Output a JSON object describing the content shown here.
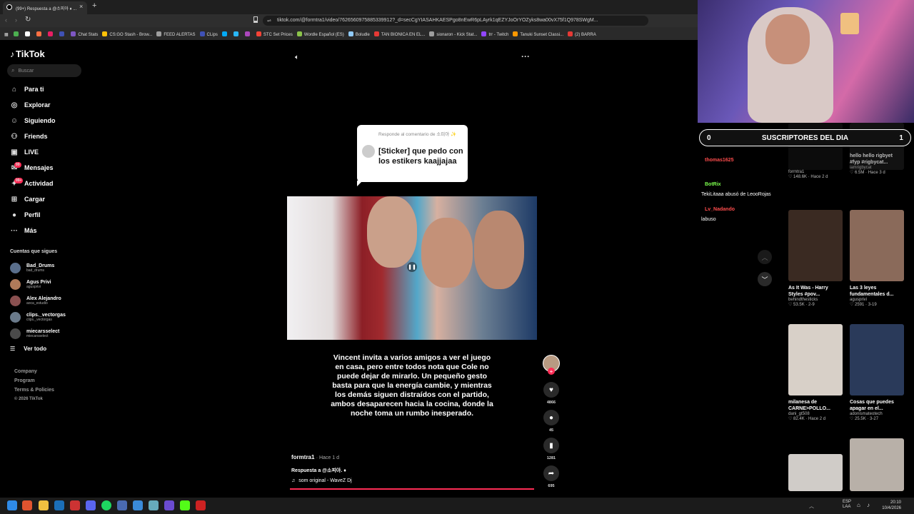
{
  "browser": {
    "tab_title": "(99+) Respuesta a @소피아 ♦ ...",
    "new_tab": "+",
    "url": "tiktok.com/@formtra1/video/7626560975885339912?_d=secCgYIASAHKAESPgo8nEwR6pLAyrk1qEZYJoOrYOZyks8wa00vX75f1Q978SWgM...",
    "bookmarks": [
      {
        "label": "",
        "color": "#4caf50"
      },
      {
        "label": "",
        "color": "#ffffff"
      },
      {
        "label": "",
        "color": "#ff7043"
      },
      {
        "label": "",
        "color": "#e91e63"
      },
      {
        "label": "",
        "color": "#3f51b5"
      },
      {
        "label": "Chat Stats",
        "color": "#7e57c2"
      },
      {
        "label": "CS:GO Stash - Brow...",
        "color": "#ffc107"
      },
      {
        "label": "FEED ALERTAS",
        "color": "#9e9e9e"
      },
      {
        "label": "CLips",
        "color": "#3f51b5"
      },
      {
        "label": "",
        "color": "#03a9f4"
      },
      {
        "label": "",
        "color": "#29b6f6"
      },
      {
        "label": "",
        "color": "#ab47bc"
      },
      {
        "label": "STC Set Prices",
        "color": "#f44336"
      },
      {
        "label": "Wordle Español (ES)",
        "color": "#8bc34a"
      },
      {
        "label": "Boludle",
        "color": "#90caf9"
      },
      {
        "label": "TAN BIONICA EN EL...",
        "color": "#e53935"
      },
      {
        "label": "sionaron - Kick Stat...",
        "color": "#9e9e9e"
      },
      {
        "label": "trr - Twitch",
        "color": "#9146ff"
      },
      {
        "label": "Tanuki Sunset Classi...",
        "color": "#ff9800"
      },
      {
        "label": "(2) BARRA",
        "color": "#e53935"
      }
    ]
  },
  "tiktok": {
    "logo": "TikTok",
    "search_placeholder": "Buscar",
    "nav": [
      {
        "label": "Para ti",
        "icon": "home-icon",
        "badge": ""
      },
      {
        "label": "Explorar",
        "icon": "compass-icon",
        "badge": ""
      },
      {
        "label": "Siguiendo",
        "icon": "following-icon",
        "badge": ""
      },
      {
        "label": "Friends",
        "icon": "friends-icon",
        "badge": ""
      },
      {
        "label": "LIVE",
        "icon": "live-icon",
        "badge": ""
      },
      {
        "label": "Mensajes",
        "icon": "messages-icon",
        "badge": "99"
      },
      {
        "label": "Actividad",
        "icon": "activity-icon",
        "badge": "99+"
      },
      {
        "label": "Cargar",
        "icon": "upload-icon",
        "badge": ""
      },
      {
        "label": "Perfil",
        "icon": "profile-icon",
        "badge": ""
      },
      {
        "label": "Más",
        "icon": "more-icon",
        "badge": ""
      }
    ],
    "following_title": "Cuentas que sigues",
    "following": [
      {
        "name": "Bad_Drums",
        "handle": "bad_drums",
        "color": "#5a6f8c"
      },
      {
        "name": "Agus Privi",
        "handle": "agusprivi",
        "color": "#b07a5a"
      },
      {
        "name": "Alex Alejandro",
        "handle": "aoca_estudio",
        "color": "#8a5050"
      },
      {
        "name": "clips._vectorgas",
        "handle": "clips._vectorgas",
        "color": "#6a7a8a"
      },
      {
        "name": "miecarsselect",
        "handle": "miecarsselect",
        "color": "#4a4a4a"
      }
    ],
    "see_all": "Ver todo",
    "footer": [
      "Company",
      "Program",
      "Terms & Policies"
    ],
    "copyright": "© 2026 TikTok"
  },
  "video": {
    "reply_label": "Responde al comentario de 소피아 ✨",
    "reply_text": "[Sticker] que pedo con los estikers kaajjajaa",
    "caption": "Vincent invita a varios amigos a ver el juego en casa, pero entre todos nota que Cole no puede dejar de mirarlo. Un pequeño gesto basta para que la energía cambie, y mientras los demás siguen distraídos con el partido, ambos desaparecen hacia la cocina, donde la noche toma un rumbo inesperado.",
    "author": "formtra1",
    "time": "· Hace 1 d",
    "description": "Respuesta a @소피아. ♦",
    "music": "som original - WaveZ Dj",
    "likes": "4866",
    "comments": "45",
    "saves": "1281",
    "shares": "695",
    "progress": 1.0
  },
  "overlay": {
    "subs_left": "0",
    "subs_title": "SUSCRIPTORES DEL DIA",
    "subs_right": "1",
    "chat": [
      {
        "user": "thomas1625",
        "msg": "",
        "user_color": "#ff4d4d"
      },
      {
        "user": "BotRix",
        "msg": "TekiLitaaa abusó de LeooRojas",
        "user_color": "#7cff4d"
      },
      {
        "user": "Lv_Nadando",
        "msg": "labuso",
        "user_color": "#ff4d4d"
      }
    ]
  },
  "recommended": [
    {
      "title": "",
      "user": "formtra1",
      "stats": "♡ 148.6K · Hace 2 d",
      "color": "#222"
    },
    {
      "title": "hello hello rigbyet #fyp #rigbycat...",
      "user": "iamrigbycat",
      "stats": "♡ 6.5M · Hace 3 d",
      "color": "#333"
    },
    {
      "title": "As It Was - Harry Styles #pov...",
      "user": "behindthesticks",
      "stats": "♡ 53.5K · 2-9",
      "color": "#3a2a22"
    },
    {
      "title": "Las 3 leyes fundamentales d...",
      "user": "agusprivi",
      "stats": "♡ 2591 · 3-19",
      "color": "#8a6a5a"
    },
    {
      "title": "milanesa de CARNE>POLLO...",
      "user": "dani_gt508",
      "stats": "♡ 82.4K · Hace 2 d",
      "color": "#d8d0c8"
    },
    {
      "title": "Cosas que puedes apagar en el...",
      "user": "adonismateotech",
      "stats": "♡ 25.5K · 3-27",
      "color": "#2a3a5a"
    },
    {
      "title": "",
      "user": "",
      "stats": "",
      "color": "#d0ccc8"
    },
    {
      "title": "",
      "user": "",
      "stats": "",
      "color": "#b8b0a8"
    }
  ],
  "taskbar": {
    "lang": "ESP LAA",
    "time": "20:10",
    "date": "10/4/2026"
  }
}
